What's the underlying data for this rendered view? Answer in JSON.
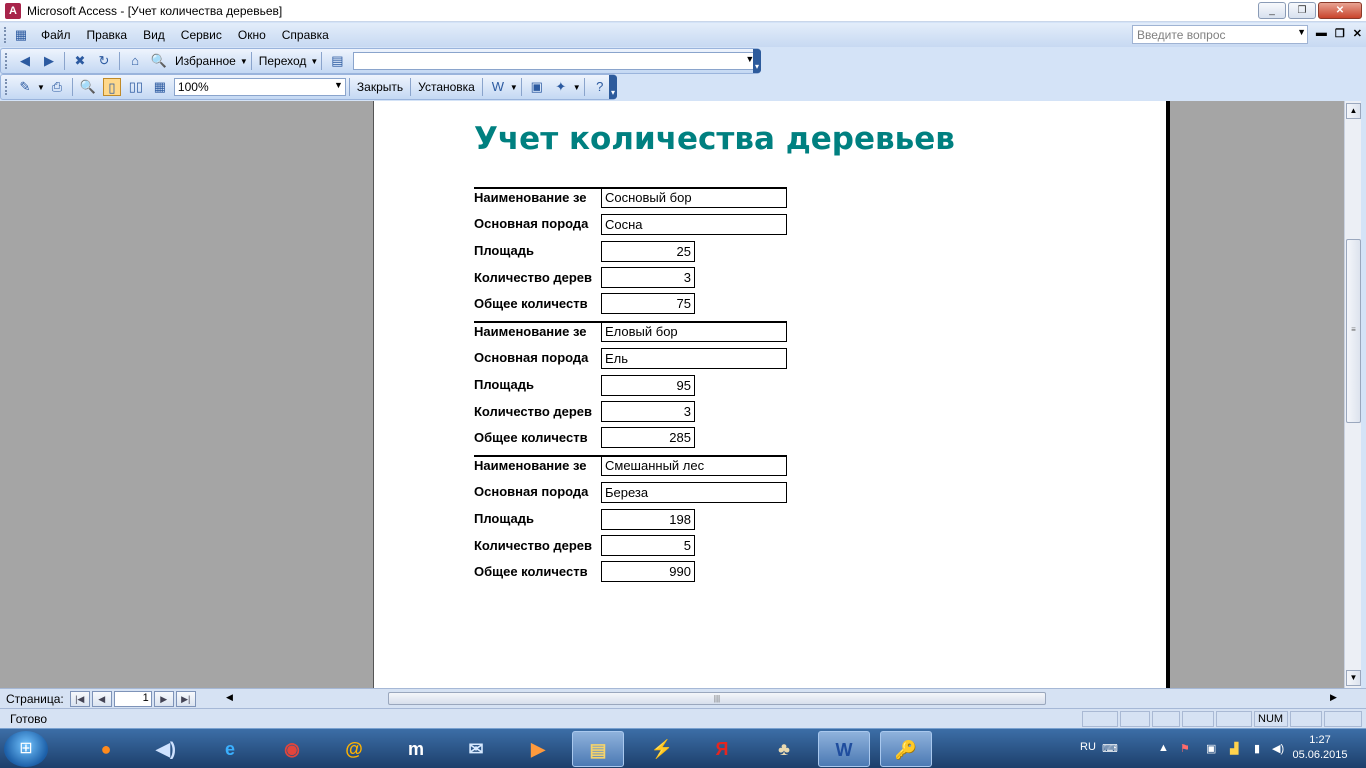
{
  "window": {
    "title": "Microsoft Access - [Учет количества деревьев]",
    "minimize": "_",
    "maximize": "❐",
    "close": "✕"
  },
  "menu": {
    "items": [
      "Файл",
      "Правка",
      "Вид",
      "Сервис",
      "Окно",
      "Справка"
    ],
    "help_placeholder": "Введите вопрос"
  },
  "web_toolbar": {
    "favorites": "Избранное",
    "go": "Переход",
    "address": ""
  },
  "preview_toolbar": {
    "zoom": "100%",
    "close": "Закрыть",
    "setup": "Установка"
  },
  "report": {
    "title": "Учет количества деревьев",
    "labels": {
      "name": "Наименование зе",
      "species": "Основная порода",
      "area": "Площадь",
      "trees": "Количество дерев",
      "total": "Общее количеств"
    },
    "records": [
      {
        "name": "Сосновый бор",
        "species": "Сосна",
        "area": "25",
        "trees": "3",
        "total": "75"
      },
      {
        "name": "Еловый бор",
        "species": "Ель",
        "area": "95",
        "trees": "3",
        "total": "285"
      },
      {
        "name": "Смешанный лес",
        "species": "Береза",
        "area": "198",
        "trees": "5",
        "total": "990"
      }
    ]
  },
  "navigation": {
    "page_label": "Страница:",
    "current_page": "1"
  },
  "status": {
    "text": "Готово",
    "num": "NUM"
  },
  "taskbar": {
    "language": "RU",
    "time": "1:27",
    "date": "05.06.2015",
    "apps": [
      "firefox",
      "volume",
      "internet-explorer",
      "chrome",
      "mail-ru-agent",
      "maxthon",
      "mail",
      "media-player",
      "explorer",
      "winamp",
      "yandex",
      "mahjong",
      "word",
      "access"
    ]
  },
  "colors": {
    "report_title": "#008080",
    "workspace": "#a5a5a5"
  }
}
